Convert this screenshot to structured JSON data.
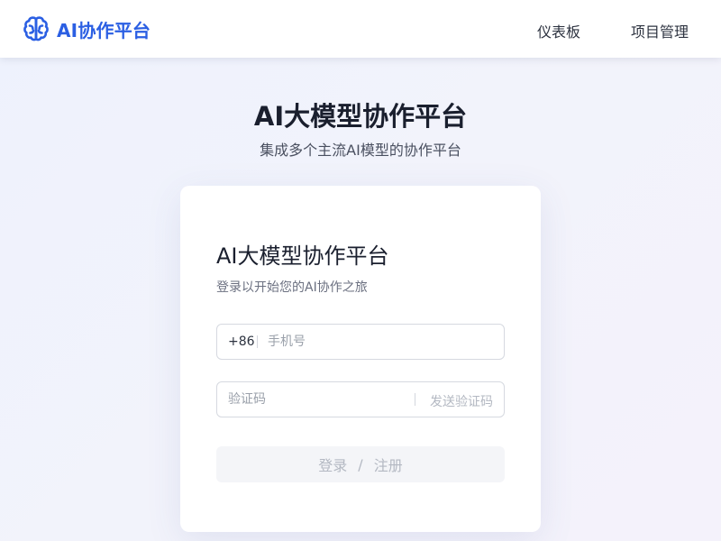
{
  "header": {
    "brand": "AI协作平台",
    "logo_icon": "brain-icon",
    "nav": [
      {
        "label": "仪表板"
      },
      {
        "label": "项目管理"
      }
    ]
  },
  "hero": {
    "title": "AI大模型协作平台",
    "subtitle": "集成多个主流AI模型的协作平台"
  },
  "login_card": {
    "title": "AI大模型协作平台",
    "subtitle": "登录以开始您的AI协作之旅",
    "phone": {
      "prefix": "+86",
      "placeholder": "手机号",
      "value": ""
    },
    "code": {
      "placeholder": "验证码",
      "value": "",
      "send_label": "发送验证码"
    },
    "submit": {
      "login_label": "登录",
      "separator": "/",
      "register_label": "注册"
    }
  },
  "colors": {
    "brand": "#2b5fe3",
    "text_primary": "#1a1f2e",
    "text_secondary": "#6b7080",
    "disabled_text": "#b3b8c2",
    "button_bg_disabled": "#f4f5f8"
  }
}
